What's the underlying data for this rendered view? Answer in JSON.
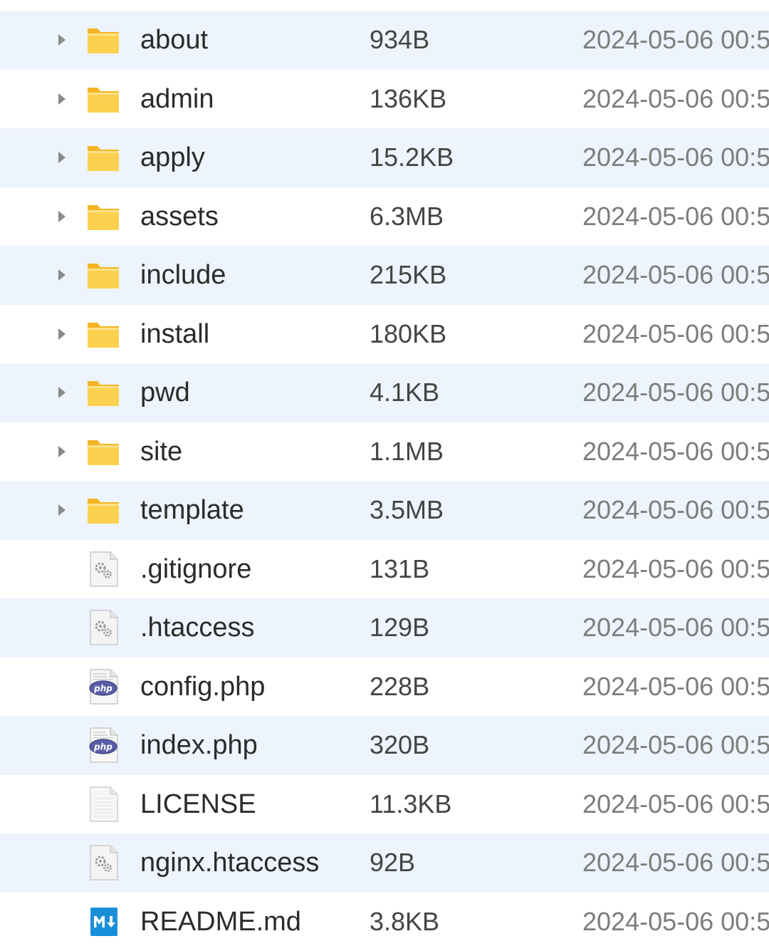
{
  "colors": {
    "row_alt_bg": "#eef4fd",
    "folder_yellow": "#fbc93d",
    "php_purple": "#5b5ea6",
    "markdown_blue": "#1a8fd9"
  },
  "files": [
    {
      "name": "about",
      "size": "934B",
      "modified": "2024-05-06 00:5",
      "type": "folder",
      "icon": "folder-icon"
    },
    {
      "name": "admin",
      "size": "136KB",
      "modified": "2024-05-06 00:5",
      "type": "folder",
      "icon": "folder-icon"
    },
    {
      "name": "apply",
      "size": "15.2KB",
      "modified": "2024-05-06 00:5",
      "type": "folder",
      "icon": "folder-icon"
    },
    {
      "name": "assets",
      "size": "6.3MB",
      "modified": "2024-05-06 00:5",
      "type": "folder",
      "icon": "folder-icon"
    },
    {
      "name": "include",
      "size": "215KB",
      "modified": "2024-05-06 00:5",
      "type": "folder",
      "icon": "folder-icon"
    },
    {
      "name": "install",
      "size": "180KB",
      "modified": "2024-05-06 00:5",
      "type": "folder",
      "icon": "folder-icon"
    },
    {
      "name": "pwd",
      "size": "4.1KB",
      "modified": "2024-05-06 00:5",
      "type": "folder",
      "icon": "folder-icon"
    },
    {
      "name": "site",
      "size": "1.1MB",
      "modified": "2024-05-06 00:5",
      "type": "folder",
      "icon": "folder-icon"
    },
    {
      "name": "template",
      "size": "3.5MB",
      "modified": "2024-05-06 00:5",
      "type": "folder",
      "icon": "folder-icon"
    },
    {
      "name": ".gitignore",
      "size": "131B",
      "modified": "2024-05-06 00:5",
      "type": "config",
      "icon": "config-file-icon"
    },
    {
      "name": ".htaccess",
      "size": "129B",
      "modified": "2024-05-06 00:5",
      "type": "config",
      "icon": "config-file-icon"
    },
    {
      "name": "config.php",
      "size": "228B",
      "modified": "2024-05-06 00:5",
      "type": "php",
      "icon": "php-file-icon"
    },
    {
      "name": "index.php",
      "size": "320B",
      "modified": "2024-05-06 00:5",
      "type": "php",
      "icon": "php-file-icon"
    },
    {
      "name": "LICENSE",
      "size": "11.3KB",
      "modified": "2024-05-06 00:5",
      "type": "text",
      "icon": "text-file-icon"
    },
    {
      "name": "nginx.htaccess",
      "size": "92B",
      "modified": "2024-05-06 00:5",
      "type": "config",
      "icon": "config-file-icon"
    },
    {
      "name": "README.md",
      "size": "3.8KB",
      "modified": "2024-05-06 00:5",
      "type": "markdown",
      "icon": "markdown-file-icon"
    }
  ]
}
